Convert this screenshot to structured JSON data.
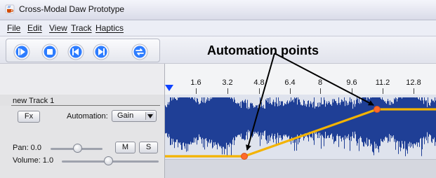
{
  "window": {
    "title": "Cross-Modal Daw Prototype",
    "icon": "java-cup-icon"
  },
  "menu": {
    "items": [
      {
        "label": "File",
        "name": "menu-file"
      },
      {
        "label": "Edit",
        "name": "menu-edit"
      },
      {
        "label": "View",
        "name": "menu-view"
      },
      {
        "label": "Track",
        "name": "menu-track"
      },
      {
        "label": "Haptics",
        "name": "menu-haptics"
      }
    ]
  },
  "toolbar": {
    "buttons": [
      {
        "name": "play-button",
        "icon": "play-icon"
      },
      {
        "name": "stop-button",
        "icon": "stop-icon"
      },
      {
        "name": "rewind-button",
        "icon": "skip-back-icon"
      },
      {
        "name": "forward-button",
        "icon": "skip-forward-icon"
      },
      {
        "name": "loop-button",
        "icon": "loop-icon"
      }
    ]
  },
  "track": {
    "name": "new Track 1",
    "fx_label": "Fx",
    "automation_label": "Automation:",
    "automation_value": "Gain",
    "pan_label": "Pan: 0.0",
    "mute_label": "M",
    "solo_label": "S",
    "volume_label": "Volume: 1.0",
    "pan_value": 0.5,
    "volume_value": 0.72
  },
  "ruler": {
    "ticks": [
      "1.6",
      "3.2",
      "4.8",
      "6.4",
      "8",
      "9.6",
      "11.2",
      "12.8"
    ]
  },
  "annotation": {
    "text": "Automation points"
  },
  "colors": {
    "waveform": "#1f3f96",
    "automation_line": "#f3b300",
    "automation_point": "#ff6a2a",
    "playhead": "#0f43ff",
    "toolbar_button": "#2d7cff"
  }
}
